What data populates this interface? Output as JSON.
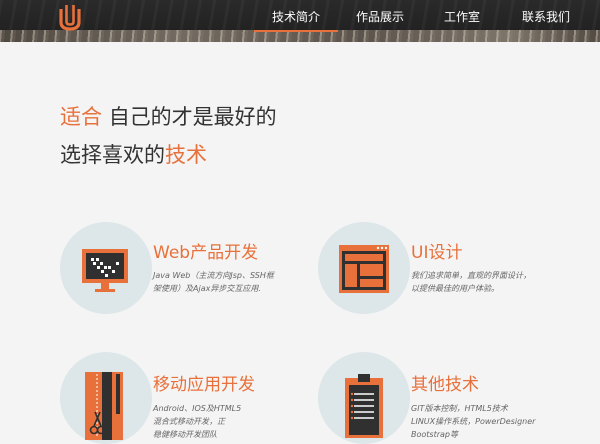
{
  "colors": {
    "accent": "#e8703a",
    "header_bg": "#262626",
    "circle_bg": "#dde6e8"
  },
  "header": {
    "logo": "brand-logo",
    "nav": [
      {
        "label": "技术简介",
        "active": true
      },
      {
        "label": "作品展示",
        "active": false
      },
      {
        "label": "工作室",
        "active": false
      },
      {
        "label": "联系我们",
        "active": false
      }
    ]
  },
  "hero": {
    "line1_accent": "适合",
    "line1_rest": "自己的才是最好的",
    "line2_rest": "选择喜欢的",
    "line2_accent": "技术"
  },
  "features": [
    {
      "icon": "monitor-icon",
      "title": "Web产品开发",
      "desc_lines": [
        "Java Web（主流方向Jsp、SSH框",
        "架使用）及Ajax异步交互应用."
      ]
    },
    {
      "icon": "layout-icon",
      "title": "UI设计",
      "desc_lines": [
        "我们追求简单，直观的界面设计，",
        "以提供最佳的用户体验。"
      ]
    },
    {
      "icon": "tools-icon",
      "title": "移动应用开发",
      "desc_lines": [
        "Android、IOS及HTML5",
        "混合式移动开发，正",
        "稳健移动开发团队"
      ]
    },
    {
      "icon": "clipboard-icon",
      "title": "其他技术",
      "desc_lines": [
        "GIT版本控制，HTML5技术",
        "LINUX操作系统，PowerDesigner",
        "Bootstrap等"
      ]
    }
  ]
}
